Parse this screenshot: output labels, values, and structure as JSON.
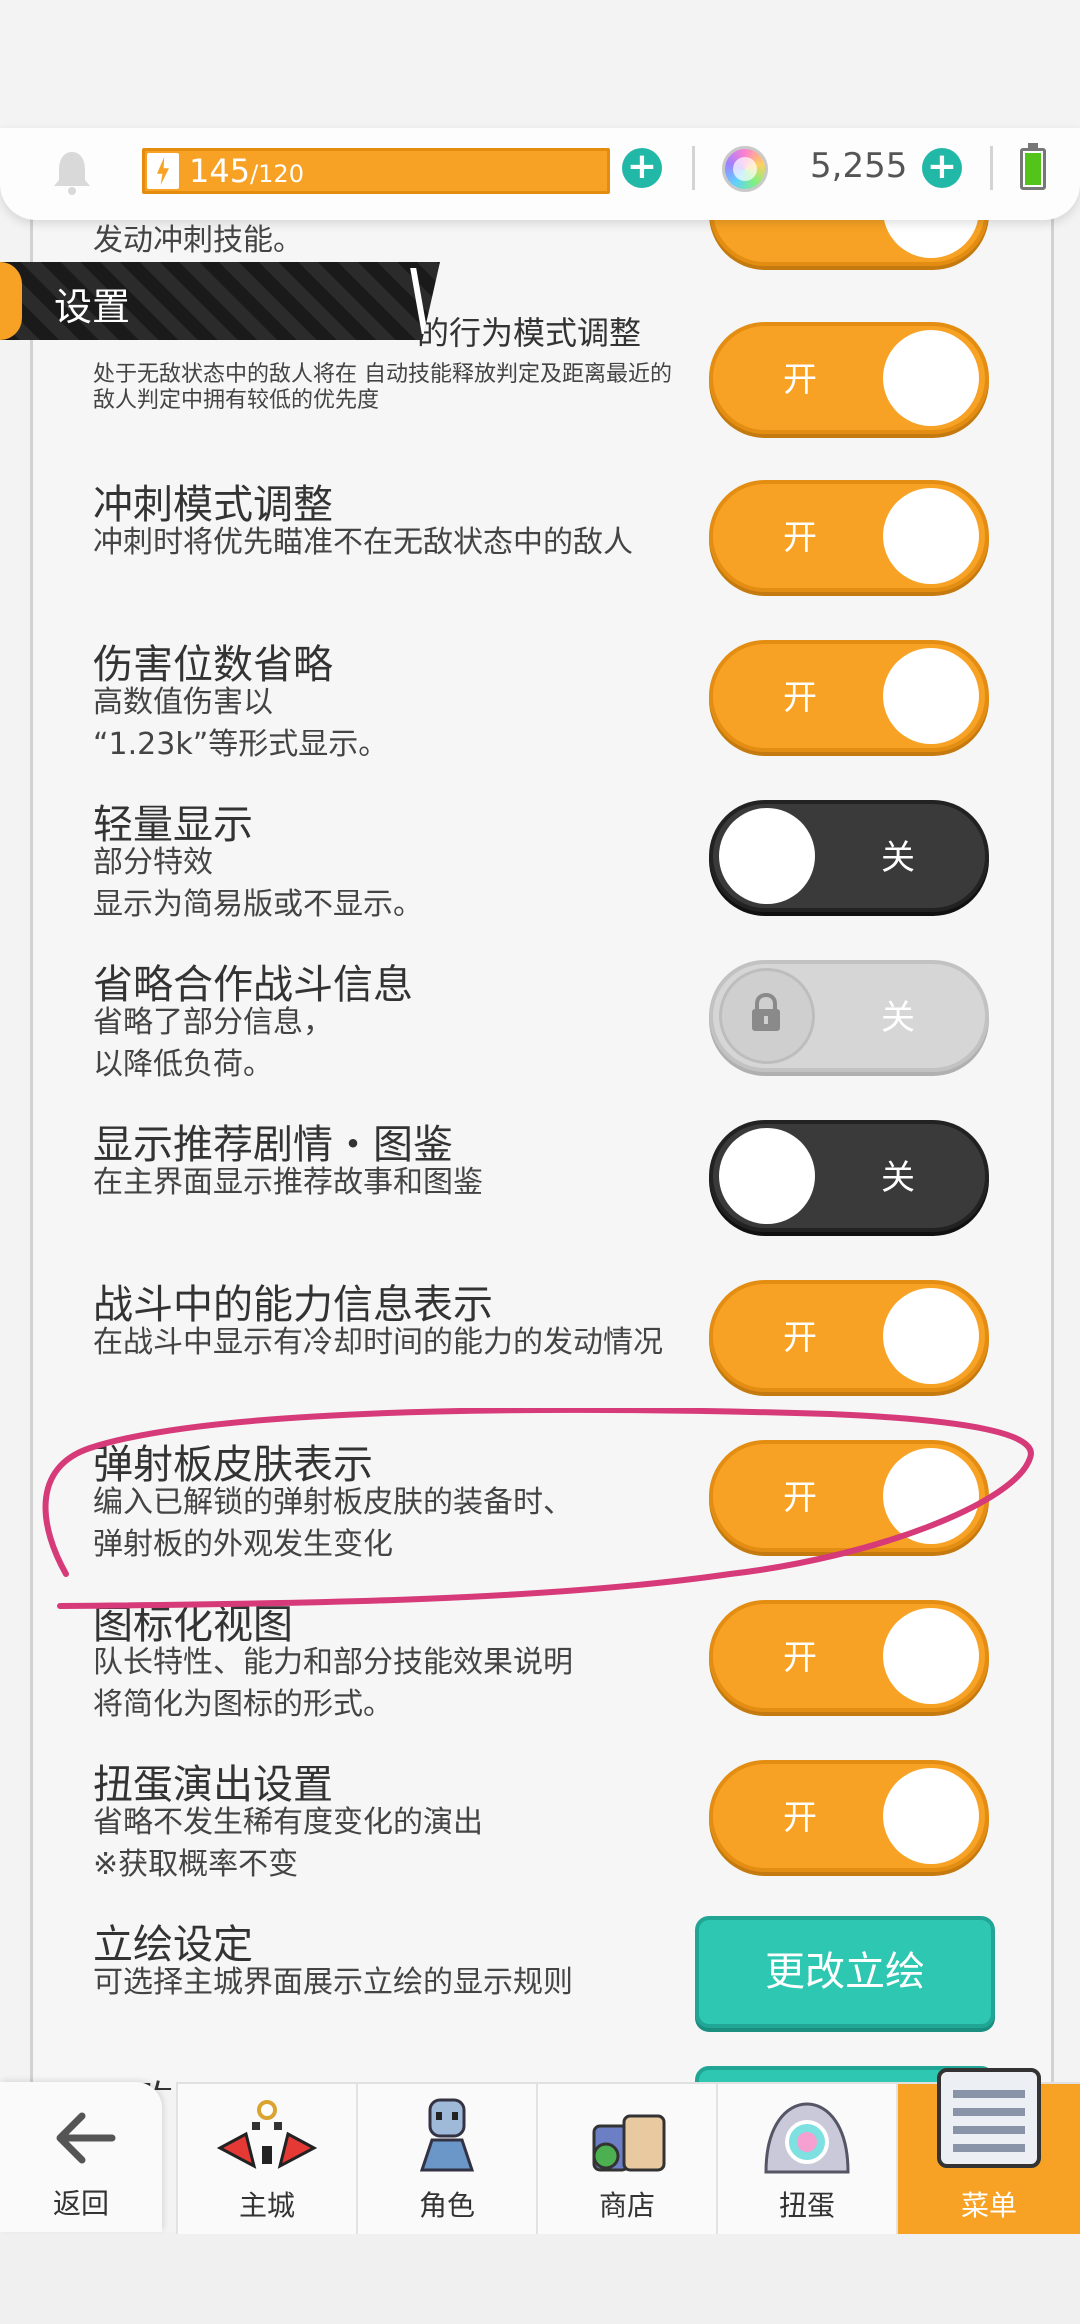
{
  "topbar": {
    "stamina_current": "145",
    "stamina_max": "/120",
    "gems": "5,255"
  },
  "header": {
    "title": "设置"
  },
  "rows": [
    {
      "title": "",
      "desc": "发动冲刺技能。",
      "toggle": "开"
    },
    {
      "title": "的行为模式调整",
      "desc": "处于无敌状态中的敌人将在\n自动技能释放判定及距离最近的敌人判定中拥有较低的优先度",
      "toggle": "开"
    },
    {
      "title": "冲刺模式调整",
      "desc": "冲刺时将优先瞄准不在无敌状态中的敌人",
      "toggle": "开"
    },
    {
      "title": "伤害位数省略",
      "desc": "高数值伤害以\n“1.23k”等形式显示。",
      "toggle": "开"
    },
    {
      "title": "轻量显示",
      "desc": "部分特效\n显示为简易版或不显示。",
      "toggle": "关"
    },
    {
      "title": "省略合作战斗信息",
      "desc": "省略了部分信息，\n以降低负荷。",
      "toggle": "关"
    },
    {
      "title": "显示推荐剧情・图鉴",
      "desc": "在主界面显示推荐故事和图鉴",
      "toggle": "关"
    },
    {
      "title": "战斗中的能力信息表示",
      "desc": "在战斗中显示有冷却时间的能力的发动情况",
      "toggle": "开"
    },
    {
      "title": "弹射板皮肤表示",
      "desc": "编入已解锁的弹射板皮肤的装备时、\n弹射板的外观发生变化",
      "toggle": "开"
    },
    {
      "title": "图标化视图",
      "desc": "队长特性、能力和部分技能效果说明\n将简化为图标的形式。",
      "toggle": "开"
    },
    {
      "title": "扭蛋演出设置",
      "desc": "省略不发生稀有度变化的演出\n※获取概率不变",
      "toggle": "开"
    },
    {
      "title": "立绘设定",
      "desc": "可选择主城界面展示立绘的显示规则",
      "button": "更改立绘"
    },
    {
      "title": "更改BGM",
      "desc": ""
    }
  ],
  "nav": {
    "back": "返回",
    "tabs": [
      "主城",
      "角色",
      "商店",
      "扭蛋",
      "菜单"
    ]
  },
  "colors": {
    "accent": "#f7a224",
    "teal": "#2ec7b2",
    "toggle_off": "#3a3a3a",
    "annotation": "#d63a78"
  }
}
